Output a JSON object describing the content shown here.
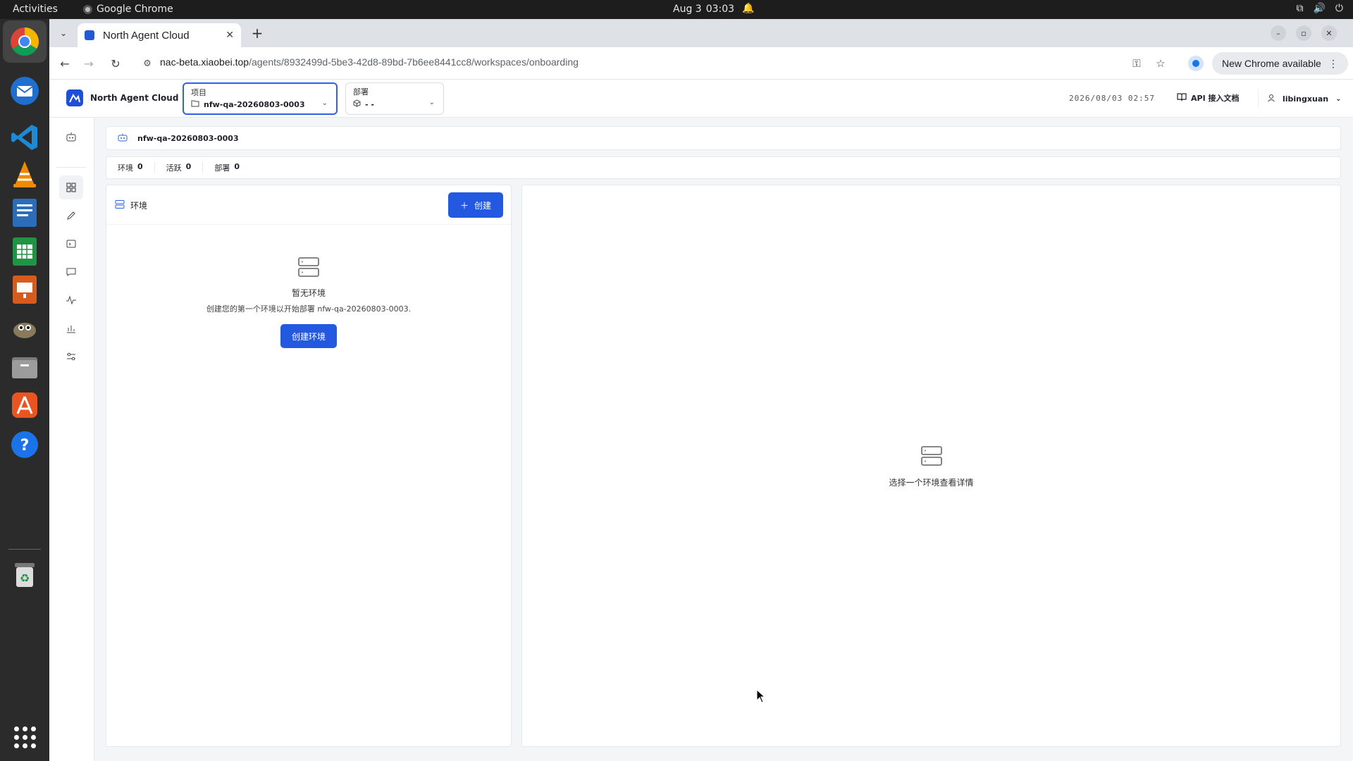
{
  "system": {
    "activities": "Activities",
    "app_name": "Google Chrome",
    "date": "Aug 3",
    "time": "03:03"
  },
  "browser": {
    "tab_title": "North Agent Cloud",
    "url_host": "nac-beta.xiaobei.top",
    "url_path": "/agents/8932499d-5be3-42d8-89bd-7b6ee8441cc8/workspaces/onboarding",
    "update_label": "New Chrome available"
  },
  "app": {
    "brand": "North Agent Cloud",
    "project": {
      "label": "项目",
      "value": "nfw-qa-20260803-0003"
    },
    "deploy": {
      "label": "部署",
      "value": "- -"
    },
    "timestamp": "2026/08/03 02:57",
    "docs_label": "API 接入文档",
    "user": "libingxuan"
  },
  "workspace": {
    "name": "nfw-qa-20260803-0003",
    "stats": [
      {
        "label": "环境",
        "value": "0"
      },
      {
        "label": "活跃",
        "value": "0"
      },
      {
        "label": "部署",
        "value": "0"
      }
    ]
  },
  "env_panel": {
    "title": "环境",
    "create_label": "创建",
    "empty_title": "暂无环境",
    "empty_desc": "创建您的第一个环境以开始部署 nfw-qa-20260803-0003.",
    "empty_button": "创建环境"
  },
  "detail_panel": {
    "empty_text": "选择一个环境查看详情"
  },
  "colors": {
    "accent": "#2358e0",
    "topbar": "#1d1d1d",
    "dock": "#2b2b2b"
  }
}
